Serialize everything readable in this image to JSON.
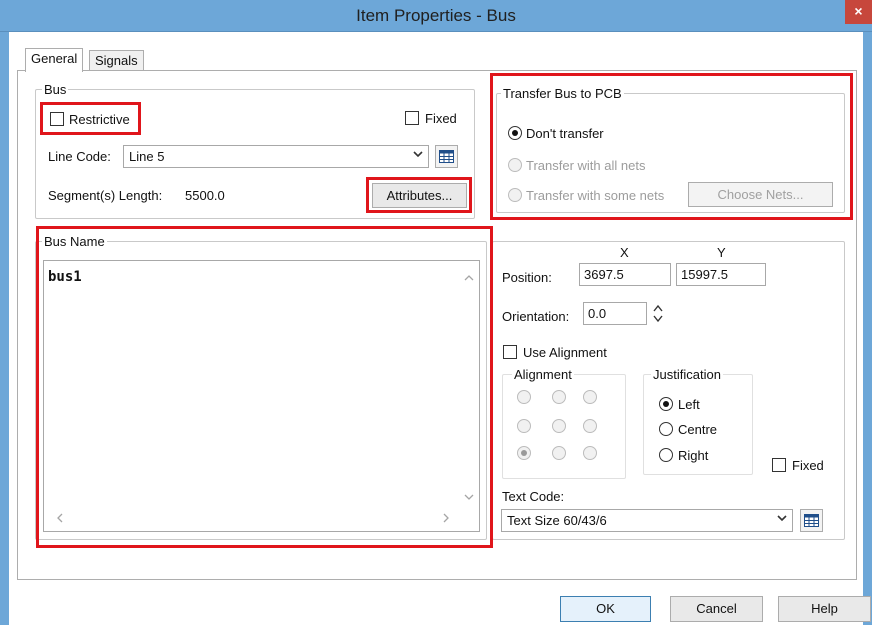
{
  "window": {
    "title": "Item Properties - Bus",
    "close_glyph": "×"
  },
  "tabs": [
    {
      "label": "General",
      "active": true
    },
    {
      "label": "Signals",
      "active": false
    }
  ],
  "bus_group": {
    "title": "Bus",
    "restrictive_label": "Restrictive",
    "restrictive_checked": false,
    "fixed_label": "Fixed",
    "fixed_checked": false,
    "line_code_label": "Line Code:",
    "line_code_value": "Line 5",
    "segment_length_label": "Segment(s) Length:",
    "segment_length_value": "5500.0",
    "attributes_button": "Attributes..."
  },
  "transfer_group": {
    "title": "Transfer Bus to PCB",
    "options": [
      {
        "label": "Don't transfer",
        "checked": true,
        "enabled": true
      },
      {
        "label": "Transfer with all nets",
        "checked": false,
        "enabled": false
      },
      {
        "label": "Transfer with some nets",
        "checked": false,
        "enabled": false
      }
    ],
    "choose_nets_button": "Choose Nets..."
  },
  "bus_name_group": {
    "title": "Bus Name",
    "text": "bus1"
  },
  "text_props": {
    "x_header": "X",
    "y_header": "Y",
    "position_label": "Position:",
    "position_x": "3697.5",
    "position_y": "15997.5",
    "orientation_label": "Orientation:",
    "orientation_value": "0.0",
    "use_alignment_label": "Use Alignment",
    "use_alignment_checked": false,
    "alignment_title": "Alignment",
    "alignment_selected": "bottom-left",
    "justification_title": "Justification",
    "justification_options": [
      {
        "label": "Left",
        "checked": true
      },
      {
        "label": "Centre",
        "checked": false
      },
      {
        "label": "Right",
        "checked": false
      }
    ],
    "fixed_label": "Fixed",
    "fixed_checked": false,
    "text_code_label": "Text Code:",
    "text_code_value": "Text Size 60/43/6"
  },
  "footer": {
    "ok_label": "OK",
    "cancel_label": "Cancel",
    "help_label": "Help"
  },
  "icons": {
    "dropdown": "chevron-down-icon",
    "table": "table-grid-icon",
    "spinner": "spinner-arrows-icon",
    "scroll_up": "scroll-up-icon",
    "scroll_down": "scroll-down-icon",
    "scroll_left": "scroll-left-icon",
    "scroll_right": "scroll-right-icon"
  },
  "colors": {
    "titlebar": "#6da7d8",
    "close_button": "#c7473c",
    "highlight": "#e0151b"
  }
}
